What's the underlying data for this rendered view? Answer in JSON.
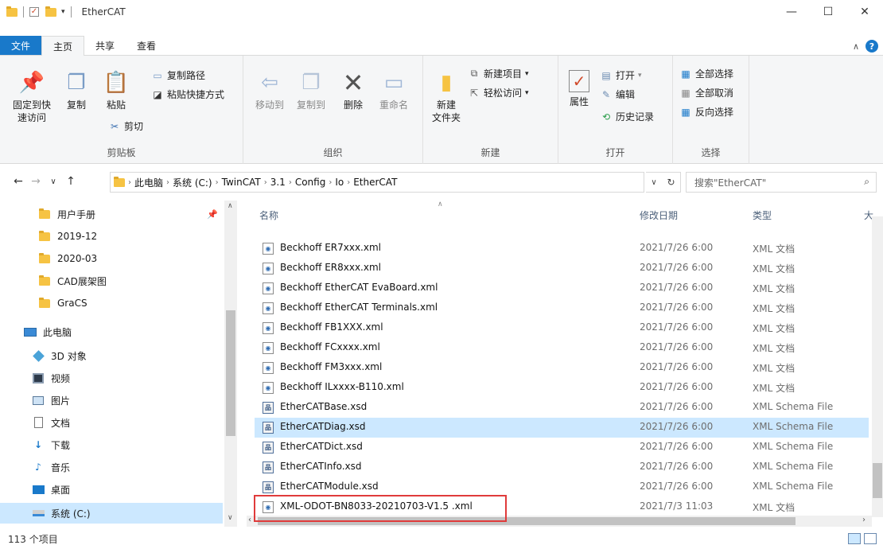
{
  "titlebar": {
    "title": "EtherCAT",
    "minimize": "—",
    "maximize": "☐",
    "close": "✕"
  },
  "tabs": [
    {
      "label": "文件"
    },
    {
      "label": "主页"
    },
    {
      "label": "共享"
    },
    {
      "label": "查看"
    }
  ],
  "ribbon": {
    "clipboard": {
      "pin_line1": "固定到快",
      "pin_line2": "速访问",
      "copy": "复制",
      "paste": "粘贴",
      "copy_path": "复制路径",
      "paste_shortcut": "粘贴快捷方式",
      "cut": "剪切",
      "label": "剪贴板"
    },
    "organize": {
      "move_to": "移动到",
      "copy_to": "复制到",
      "delete": "删除",
      "rename": "重命名",
      "label": "组织"
    },
    "new": {
      "new_item": "新建项目",
      "easy_access": "轻松访问",
      "new_folder_line1": "新建",
      "new_folder_line2": "文件夹",
      "label": "新建"
    },
    "open": {
      "properties": "属性",
      "open": "打开",
      "edit": "编辑",
      "history": "历史记录",
      "label": "打开"
    },
    "select": {
      "select_all": "全部选择",
      "select_none": "全部取消",
      "invert": "反向选择",
      "label": "选择"
    }
  },
  "address": {
    "crumbs": [
      "此电脑",
      "系统 (C:)",
      "TwinCAT",
      "3.1",
      "Config",
      "Io",
      "EtherCAT"
    ],
    "search_placeholder": "搜索\"EtherCAT\""
  },
  "nav": {
    "items": [
      {
        "label": "用户手册",
        "icon": "folder-icon"
      },
      {
        "label": "2019-12",
        "icon": "folder-icon"
      },
      {
        "label": "2020-03",
        "icon": "folder-icon"
      },
      {
        "label": "CAD展架图",
        "icon": "folder-icon"
      },
      {
        "label": "GraCS",
        "icon": "folder-icon"
      },
      {
        "label": "此电脑",
        "icon": "computer-icon"
      },
      {
        "label": "3D 对象",
        "icon": "3d-objects-icon"
      },
      {
        "label": "视频",
        "icon": "video-icon"
      },
      {
        "label": "图片",
        "icon": "pictures-icon"
      },
      {
        "label": "文档",
        "icon": "documents-icon"
      },
      {
        "label": "下载",
        "icon": "download-icon"
      },
      {
        "label": "音乐",
        "icon": "music-icon"
      },
      {
        "label": "桌面",
        "icon": "desktop-icon"
      },
      {
        "label": "系统 (C:)",
        "icon": "drive-icon"
      }
    ]
  },
  "columns": {
    "name": "名称",
    "date": "修改日期",
    "type": "类型",
    "size": "大"
  },
  "files": [
    {
      "name": "Beckhoff ER7xxx.xml",
      "date": "2021/7/26 6:00",
      "type": "XML 文档",
      "kind": "xml"
    },
    {
      "name": "Beckhoff ER8xxx.xml",
      "date": "2021/7/26 6:00",
      "type": "XML 文档",
      "kind": "xml"
    },
    {
      "name": "Beckhoff EtherCAT EvaBoard.xml",
      "date": "2021/7/26 6:00",
      "type": "XML 文档",
      "kind": "xml"
    },
    {
      "name": "Beckhoff EtherCAT Terminals.xml",
      "date": "2021/7/26 6:00",
      "type": "XML 文档",
      "kind": "xml"
    },
    {
      "name": "Beckhoff FB1XXX.xml",
      "date": "2021/7/26 6:00",
      "type": "XML 文档",
      "kind": "xml"
    },
    {
      "name": "Beckhoff FCxxxx.xml",
      "date": "2021/7/26 6:00",
      "type": "XML 文档",
      "kind": "xml"
    },
    {
      "name": "Beckhoff FM3xxx.xml",
      "date": "2021/7/26 6:00",
      "type": "XML 文档",
      "kind": "xml"
    },
    {
      "name": "Beckhoff ILxxxx-B110.xml",
      "date": "2021/7/26 6:00",
      "type": "XML 文档",
      "kind": "xml"
    },
    {
      "name": "EtherCATBase.xsd",
      "date": "2021/7/26 6:00",
      "type": "XML Schema File",
      "kind": "xsd"
    },
    {
      "name": "EtherCATDiag.xsd",
      "date": "2021/7/26 6:00",
      "type": "XML Schema File",
      "kind": "xsd"
    },
    {
      "name": "EtherCATDict.xsd",
      "date": "2021/7/26 6:00",
      "type": "XML Schema File",
      "kind": "xsd"
    },
    {
      "name": "EtherCATInfo.xsd",
      "date": "2021/7/26 6:00",
      "type": "XML Schema File",
      "kind": "xsd"
    },
    {
      "name": "EtherCATModule.xsd",
      "date": "2021/7/26 6:00",
      "type": "XML Schema File",
      "kind": "xsd"
    },
    {
      "name": "XML-ODOT-BN8033-20210703-V1.5 .xml",
      "date": "2021/7/3 11:03",
      "type": "XML 文档",
      "kind": "xml"
    }
  ],
  "status": {
    "count": "113 个项目"
  },
  "colors": {
    "accent": "#1979ca",
    "selection": "#cce8ff",
    "highlight_box": "#e03b3b",
    "folder": "#f6c343"
  }
}
